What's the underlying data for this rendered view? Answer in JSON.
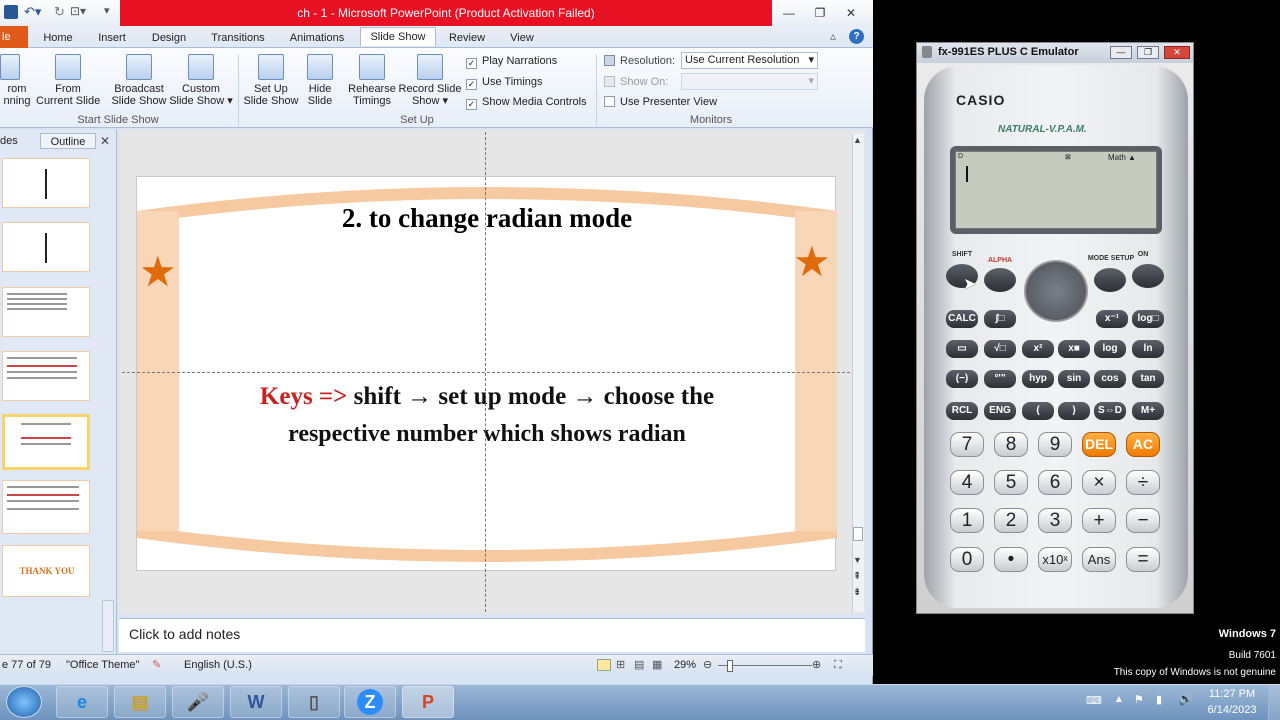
{
  "window": {
    "title": "ch - 1  -  Microsoft PowerPoint (Product Activation Failed)"
  },
  "tabs": [
    "Home",
    "Insert",
    "Design",
    "Transitions",
    "Animations",
    "Slide Show",
    "Review",
    "View"
  ],
  "file_tab": "le",
  "ribbon": {
    "btn_from_beginning": "rom\nnning",
    "btn_from_current": "From\nCurrent Slide",
    "btn_broadcast": "Broadcast\nSlide Show",
    "btn_custom": "Custom\nSlide Show ▾",
    "group_start": "Start Slide Show",
    "btn_setup": "Set Up\nSlide Show",
    "btn_hide": "Hide\nSlide",
    "btn_rehearse": "Rehearse\nTimings",
    "btn_record": "Record Slide\nShow ▾",
    "chk_narrations": "Play Narrations",
    "chk_timings": "Use Timings",
    "chk_media": "Show Media Controls",
    "group_setup": "Set Up",
    "resolution_label": "Resolution:",
    "resolution_value": "Use Current Resolution",
    "show_on_label": "Show On:",
    "presenter_view": "Use Presenter View",
    "group_monitors": "Monitors"
  },
  "panel": {
    "tab_slides": "des",
    "tab_outline": "Outline",
    "thankyou": "THANK  YOU"
  },
  "slide": {
    "title": "2. to change radian mode",
    "keys_label": "Keys =>",
    "body_line1": "shift → set up mode → choose the",
    "body_line2": "respective  number  which  shows  radian"
  },
  "notes": {
    "placeholder": "Click to add notes"
  },
  "status": {
    "slide_count": "e 77 of 79",
    "theme": "\"Office Theme\"",
    "language": "English (U.S.)",
    "zoom": "29%"
  },
  "calc": {
    "window_title": "fx-991ES PLUS C Emulator",
    "brand": "CASIO",
    "model": "NATURAL-V.P.A.M.",
    "display_indicators": "D",
    "display_math": "Math ▲",
    "row_fn": [
      "SHIFT",
      "ALPHA",
      "MODE SETUP",
      "ON"
    ],
    "row1": [
      "CALC",
      "∫□",
      "x⁻¹",
      "log□"
    ],
    "row2": [
      "▭",
      "√□",
      "x²",
      "x■",
      "log",
      "ln"
    ],
    "row3": [
      "(−)",
      "°'\"",
      "hyp",
      "sin",
      "cos",
      "tan"
    ],
    "row4": [
      "RCL",
      "ENG",
      "(",
      ")",
      "S⇔D",
      "M+"
    ],
    "num1": [
      "7",
      "8",
      "9",
      "DEL",
      "AC"
    ],
    "num2": [
      "4",
      "5",
      "6",
      "×",
      "÷"
    ],
    "num3": [
      "1",
      "2",
      "3",
      "+",
      "−"
    ],
    "num4": [
      "0",
      "•",
      "x10ˣ",
      "Ans",
      "="
    ]
  },
  "desktop": {
    "os": "Windows 7",
    "build": "Build 7601",
    "genuine": "This copy of Windows is not genuine",
    "time": "11:27 PM",
    "date": "6/14/2023"
  }
}
